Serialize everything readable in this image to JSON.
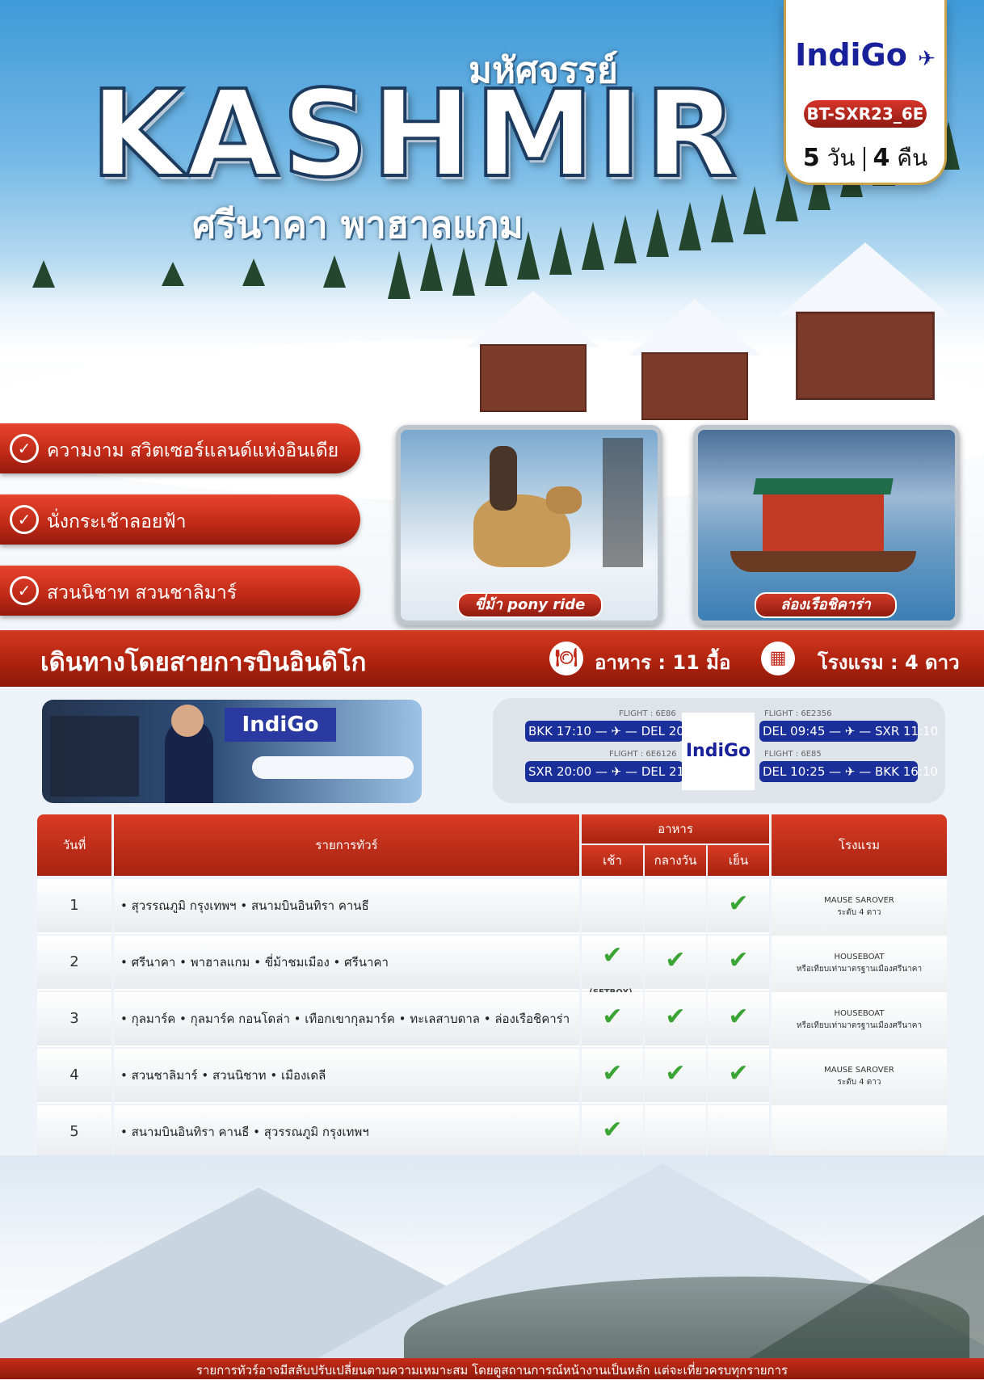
{
  "hero": {
    "tag_small": "มหัศจรรย์",
    "tag_big": "KASHMIR",
    "tag_sub": "ศรีนาคา พาฮาลแกม"
  },
  "badge": {
    "airline": "IndiGo",
    "code": "BT-SXR23_6E",
    "days_num": "5",
    "days_unit": "วัน",
    "nights_num": "4",
    "nights_unit": "คืน"
  },
  "highlights": [
    {
      "label": "ความงาม สวิตเซอร์แลนด์แห่งอินเดีย"
    },
    {
      "label": "นั่งกระเช้าลอยฟ้า"
    },
    {
      "label": "สวนนิชาท สวนชาลิมาร์"
    }
  ],
  "photos": [
    {
      "caption": "ขี่ม้า pony ride",
      "icon": "horse-photo"
    },
    {
      "caption": "ล่องเรือชิคาร่า",
      "icon": "shikara-boat-photo"
    }
  ],
  "bar": {
    "title": "เดินทางโดยสายการบินอินดิโก",
    "meals_label": "อาหาร : 11 มื้อ",
    "hotel_label": "โรงแรม : 4 ดาว"
  },
  "airline_banner": {
    "logo": "IndiGo"
  },
  "flights": {
    "center_logo": "IndiGo",
    "items": [
      {
        "flight": "FLIGHT : 6E86",
        "route": "BKK 17:10 — ✈ — DEL 20:20"
      },
      {
        "flight": "FLIGHT : 6E6126",
        "route": "SXR 20:00 — ✈ — DEL 21:45"
      },
      {
        "flight": "FLIGHT : 6E2356",
        "route": "DEL 09:45 — ✈ — SXR 11:10"
      },
      {
        "flight": "FLIGHT : 6E85",
        "route": "DEL 10:25 — ✈ — BKK 16:10"
      }
    ]
  },
  "table": {
    "headers": {
      "day": "วันที่",
      "program": "รายการทัวร์",
      "meals": "อาหาร",
      "breakfast": "เช้า",
      "lunch": "กลางวัน",
      "dinner": "เย็น",
      "hotel": "โรงแรม"
    },
    "rows": [
      {
        "day": "1",
        "program": "• สุวรรณภูมิ กรุงเทพฯ • สนามบินอินทิรา คานธี",
        "b": "",
        "l": "",
        "d": "✔",
        "b_note": "",
        "hotel1": "MAUSE SAROVER",
        "hotel2": "ระดับ 4 ดาว"
      },
      {
        "day": "2",
        "program": "• ศรีนาคา • พาฮาลแกม • ขี่ม้าชมเมือง • ศรีนาคา",
        "b": "✔",
        "l": "✔",
        "d": "✔",
        "b_note": "(SETBOX)",
        "hotel1": "HOUSEBOAT",
        "hotel2": "หรือเทียบเท่ามาตรฐานเมืองศรีนาคา"
      },
      {
        "day": "3",
        "program": "• กุลมาร์ค • กุลมาร์ค กอนโดล่า • เทือกเขากุลมาร์ค • ทะเลสาบดาล • ล่องเรือชิคาร่า",
        "b": "✔",
        "l": "✔",
        "d": "✔",
        "b_note": "",
        "hotel1": "HOUSEBOAT",
        "hotel2": "หรือเทียบเท่ามาตรฐานเมืองศรีนาคา"
      },
      {
        "day": "4",
        "program": "• สวนชาลิมาร์ • สวนนิชาท • เมืองเดลี",
        "b": "✔",
        "l": "✔",
        "d": "✔",
        "b_note": "",
        "hotel1": "MAUSE SAROVER",
        "hotel2": "ระดับ 4 ดาว"
      },
      {
        "day": "5",
        "program": "• สนามบินอินทิรา คานธี • สุวรรณภูมิ กรุงเทพฯ",
        "b": "✔",
        "l": "",
        "d": "",
        "b_note": "",
        "hotel1": "",
        "hotel2": ""
      }
    ]
  },
  "footer": {
    "text": "รายการทัวร์อาจมีสลับปรับเปลี่ยนตามความเหมาะสม โดยดูสถานการณ์หน้างานเป็นหลัก แต่จะเที่ยวครบทุกรายการ"
  },
  "colors": {
    "brand_red": "#c0281a",
    "indigo_blue": "#1a2f99",
    "check_green": "#3aa535"
  }
}
